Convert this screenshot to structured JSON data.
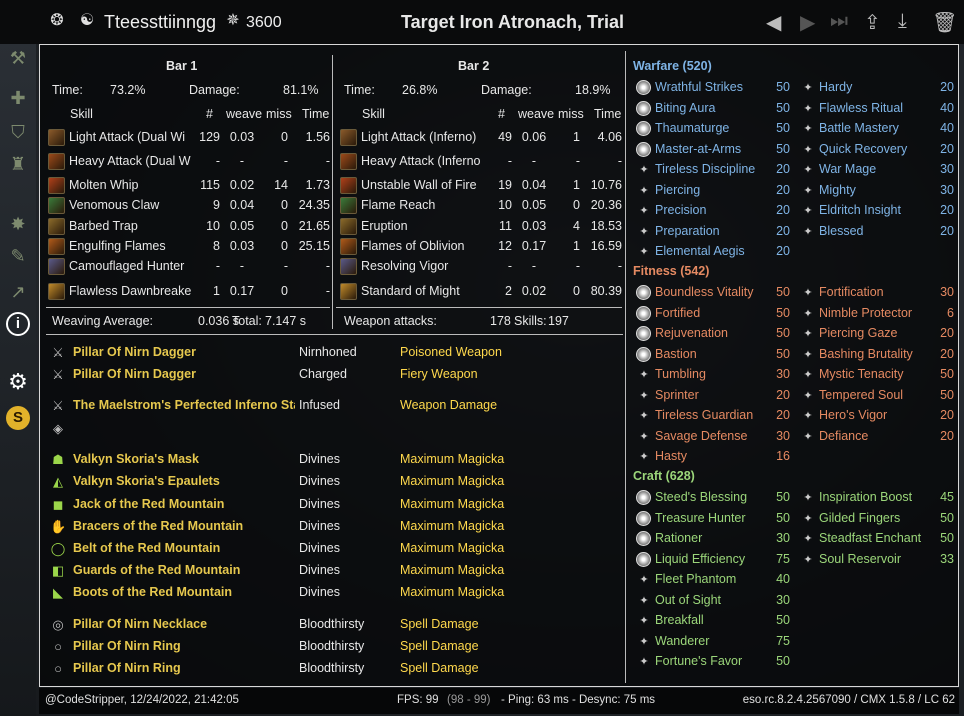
{
  "topbar": {
    "player": "Tteessttiinngg",
    "cp": "3600",
    "title": "Target Iron Atronach, Trial"
  },
  "bar1": {
    "header": "Bar 1",
    "time_label": "Time:",
    "time_value": "73.2%",
    "damage_label": "Damage:",
    "damage_value": "81.1%",
    "cols": {
      "skill": "Skill",
      "count": "#",
      "weave": "weave",
      "miss": "miss",
      "time": "Time"
    },
    "rows": [
      {
        "skill": "Light Attack (Dual Wi",
        "count": "129",
        "weave": "0.03",
        "miss": "0",
        "time": "1.56"
      },
      {
        "skill": "Heavy Attack (Dual W",
        "count": "-",
        "weave": "-",
        "miss": "-",
        "time": "-"
      },
      {
        "skill": "Molten Whip",
        "count": "115",
        "weave": "0.02",
        "miss": "14",
        "time": "1.73"
      },
      {
        "skill": "Venomous Claw",
        "count": "9",
        "weave": "0.04",
        "miss": "0",
        "time": "24.35"
      },
      {
        "skill": "Barbed Trap",
        "count": "10",
        "weave": "0.05",
        "miss": "0",
        "time": "21.65"
      },
      {
        "skill": "Engulfing Flames",
        "count": "8",
        "weave": "0.03",
        "miss": "0",
        "time": "25.15"
      },
      {
        "skill": "Camouflaged Hunter",
        "count": "-",
        "weave": "-",
        "miss": "-",
        "time": "-"
      },
      {
        "skill": "Flawless Dawnbreake",
        "count": "1",
        "weave": "0.17",
        "miss": "0",
        "time": "-"
      }
    ],
    "footer_label": "Weaving Average:",
    "footer_value": "0.036 s",
    "total_label": "Total:",
    "total_value": "7.147 s"
  },
  "bar2": {
    "header": "Bar 2",
    "time_label": "Time:",
    "time_value": "26.8%",
    "damage_label": "Damage:",
    "damage_value": "18.9%",
    "cols": {
      "skill": "Skill",
      "count": "#",
      "weave": "weave",
      "miss": "miss",
      "time": "Time"
    },
    "rows": [
      {
        "skill": "Light Attack (Inferno)",
        "count": "49",
        "weave": "0.06",
        "miss": "1",
        "time": "4.06"
      },
      {
        "skill": "Heavy Attack (Inferno",
        "count": "-",
        "weave": "-",
        "miss": "-",
        "time": "-"
      },
      {
        "skill": "Unstable Wall of Fire",
        "count": "19",
        "weave": "0.04",
        "miss": "1",
        "time": "10.76"
      },
      {
        "skill": "Flame Reach",
        "count": "10",
        "weave": "0.05",
        "miss": "0",
        "time": "20.36"
      },
      {
        "skill": "Eruption",
        "count": "11",
        "weave": "0.03",
        "miss": "4",
        "time": "18.53"
      },
      {
        "skill": "Flames of Oblivion",
        "count": "12",
        "weave": "0.17",
        "miss": "1",
        "time": "16.59"
      },
      {
        "skill": "Resolving Vigor",
        "count": "-",
        "weave": "-",
        "miss": "-",
        "time": "-"
      },
      {
        "skill": "Standard of Might",
        "count": "2",
        "weave": "0.02",
        "miss": "0",
        "time": "80.39"
      }
    ],
    "footer_label": "Weapon attacks:",
    "footer_value": "178",
    "skills_label": "Skills:",
    "skills_value": "197"
  },
  "gear": [
    {
      "name": "Pillar Of Nirn Dagger",
      "trait": "Nirnhoned",
      "enchant": "Poisoned Weapon",
      "icon": "dagger-icon"
    },
    {
      "name": "Pillar Of Nirn Dagger",
      "trait": "Charged",
      "enchant": "Fiery Weapon",
      "icon": "dagger-icon"
    },
    {
      "name": "The Maelstrom's Perfected Inferno Sta",
      "trait": "Infused",
      "enchant": "Weapon Damage",
      "icon": "staff-icon"
    },
    {
      "name": "",
      "trait": "",
      "enchant": "",
      "icon": "empty-slot-icon"
    },
    {
      "name": "Valkyn Skoria's Mask",
      "trait": "Divines",
      "enchant": "Maximum Magicka",
      "icon": "helmet-icon"
    },
    {
      "name": "Valkyn Skoria's Epaulets",
      "trait": "Divines",
      "enchant": "Maximum Magicka",
      "icon": "shoulder-icon"
    },
    {
      "name": "Jack of the Red Mountain",
      "trait": "Divines",
      "enchant": "Maximum Magicka",
      "icon": "chest-icon"
    },
    {
      "name": "Bracers of the Red Mountain",
      "trait": "Divines",
      "enchant": "Maximum Magicka",
      "icon": "gloves-icon"
    },
    {
      "name": "Belt of the Red Mountain",
      "trait": "Divines",
      "enchant": "Maximum Magicka",
      "icon": "belt-icon"
    },
    {
      "name": "Guards of the Red Mountain",
      "trait": "Divines",
      "enchant": "Maximum Magicka",
      "icon": "legs-icon"
    },
    {
      "name": "Boots of the Red Mountain",
      "trait": "Divines",
      "enchant": "Maximum Magicka",
      "icon": "boots-icon"
    },
    {
      "name": "Pillar Of Nirn Necklace",
      "trait": "Bloodthirsty",
      "enchant": "Spell Damage",
      "icon": "necklace-icon"
    },
    {
      "name": "Pillar Of Nirn Ring",
      "trait": "Bloodthirsty",
      "enchant": "Spell Damage",
      "icon": "ring-icon"
    },
    {
      "name": "Pillar Of Nirn Ring",
      "trait": "Bloodthirsty",
      "enchant": "Spell Damage",
      "icon": "ring-icon"
    }
  ],
  "cp": {
    "warfare": {
      "title": "Warfare (520)",
      "color": "#7fb4e6",
      "left": [
        [
          "Wrathful Strikes",
          "50"
        ],
        [
          "Biting Aura",
          "50"
        ],
        [
          "Thaumaturge",
          "50"
        ],
        [
          "Master-at-Arms",
          "50"
        ],
        [
          "Tireless Discipline",
          "20"
        ],
        [
          "Piercing",
          "20"
        ],
        [
          "Precision",
          "20"
        ],
        [
          "Preparation",
          "20"
        ],
        [
          "Elemental Aegis",
          "20"
        ]
      ],
      "right": [
        [
          "Hardy",
          "20"
        ],
        [
          "Flawless Ritual",
          "40"
        ],
        [
          "Battle Mastery",
          "40"
        ],
        [
          "Quick Recovery",
          "20"
        ],
        [
          "War Mage",
          "30"
        ],
        [
          "Mighty",
          "30"
        ],
        [
          "Eldritch Insight",
          "20"
        ],
        [
          "Blessed",
          "20"
        ]
      ]
    },
    "fitness": {
      "title": "Fitness (542)",
      "color": "#e58a62",
      "left": [
        [
          "Boundless Vitality",
          "50"
        ],
        [
          "Fortified",
          "50"
        ],
        [
          "Rejuvenation",
          "50"
        ],
        [
          "Bastion",
          "50"
        ],
        [
          "Tumbling",
          "30"
        ],
        [
          "Sprinter",
          "20"
        ],
        [
          "Tireless Guardian",
          "20"
        ],
        [
          "Savage Defense",
          "30"
        ],
        [
          "Hasty",
          "16"
        ]
      ],
      "right": [
        [
          "Fortification",
          "30"
        ],
        [
          "Nimble Protector",
          "6"
        ],
        [
          "Piercing Gaze",
          "20"
        ],
        [
          "Bashing Brutality",
          "20"
        ],
        [
          "Mystic Tenacity",
          "50"
        ],
        [
          "Tempered Soul",
          "50"
        ],
        [
          "Hero's Vigor",
          "20"
        ],
        [
          "Defiance",
          "20"
        ]
      ]
    },
    "craft": {
      "title": "Craft (628)",
      "color": "#9bd67a",
      "left": [
        [
          "Steed's Blessing",
          "50"
        ],
        [
          "Treasure Hunter",
          "50"
        ],
        [
          "Rationer",
          "30"
        ],
        [
          "Liquid Efficiency",
          "75"
        ],
        [
          "Fleet Phantom",
          "40"
        ],
        [
          "Out of Sight",
          "30"
        ],
        [
          "Breakfall",
          "50"
        ],
        [
          "Wanderer",
          "75"
        ],
        [
          "Fortune's Favor",
          "50"
        ]
      ],
      "right": [
        [
          "Inspiration Boost",
          "45"
        ],
        [
          "Gilded Fingers",
          "50"
        ],
        [
          "Steadfast Enchant",
          "50"
        ],
        [
          "Soul Reservoir",
          "33"
        ]
      ]
    }
  },
  "footer": {
    "author": "@CodeStripper, 12/24/2022, 21:42:05",
    "fps": "FPS: 99",
    "fps_range": "(98 - 99)",
    "ping": "- Ping: 63 ms - Desync: 75 ms",
    "version": "eso.rc.8.2.4.2567090 / CMX 1.5.8 / LC 62"
  }
}
